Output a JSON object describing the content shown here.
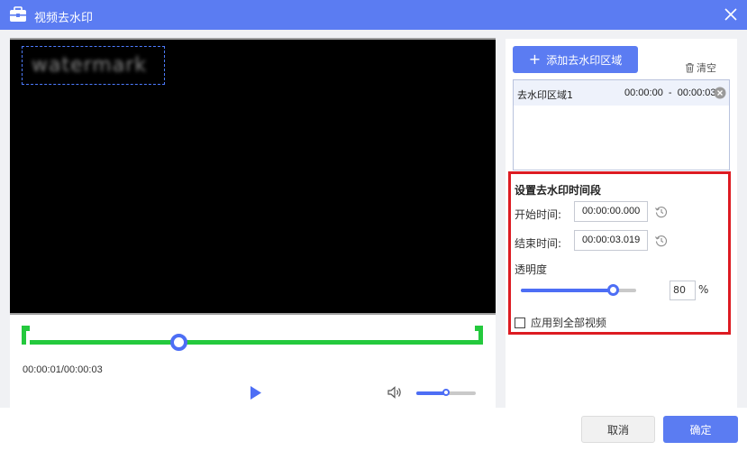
{
  "window": {
    "title": "视频去水印",
    "app_icon": "toolbox-icon",
    "close_icon": "close-icon"
  },
  "preview": {
    "watermark_text": "watermark"
  },
  "player": {
    "time_readout": "00:00:01/00:00:03",
    "position_fraction": 0.333,
    "play_icon": "play-icon",
    "volume_icon": "speaker-icon",
    "volume_fraction": 0.5
  },
  "right_panel": {
    "add_region_label": "添加去水印区域",
    "clear_label": "清空",
    "regions": [
      {
        "name": "去水印区域1",
        "time_range": "00:00:00  -  00:00:03"
      }
    ]
  },
  "settings": {
    "title": "设置去水印时间段",
    "start_label": "开始时间:",
    "start_value": "00:00:00.000",
    "end_label": "结束时间:",
    "end_value": "00:00:03.019",
    "opacity_label": "透明度",
    "opacity_value": "80",
    "opacity_unit": "%",
    "opacity_fraction": 0.8,
    "apply_all_label": "应用到全部视频",
    "apply_all_checked": false
  },
  "footer": {
    "cancel_label": "取消",
    "ok_label": "确定"
  },
  "colors": {
    "accent": "#5b7cf2",
    "timeline": "#24c93d",
    "highlight_border": "#dd1b22"
  }
}
